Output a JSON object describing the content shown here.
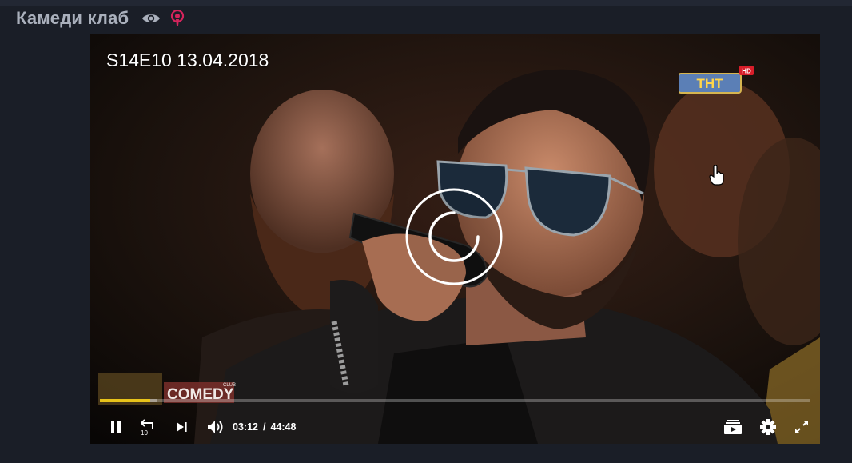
{
  "page": {
    "title": "Камеди клаб",
    "icons": [
      "eye-icon",
      "podcast-icon"
    ],
    "accent": "#d4245c"
  },
  "player": {
    "episode_label": "S14E10 13.04.2018",
    "channel_logo": {
      "text": "ТНТ",
      "badge": "HD"
    },
    "watermark": {
      "text": "COMEDY",
      "small": "CLUB"
    },
    "state": "loading",
    "current_time": "03:12",
    "time_separator": "/",
    "duration": "44:48",
    "progress_fraction": 0.0714,
    "buffer_fraction": 0.08,
    "progress_color": "#e8c31a",
    "controls": {
      "left": [
        "pause-icon",
        "rewind-10-icon",
        "skip-next-icon",
        "volume-icon"
      ],
      "right": [
        "playlist-icon",
        "settings-gear-icon",
        "fullscreen-icon"
      ],
      "rewind_seconds": "10"
    }
  }
}
